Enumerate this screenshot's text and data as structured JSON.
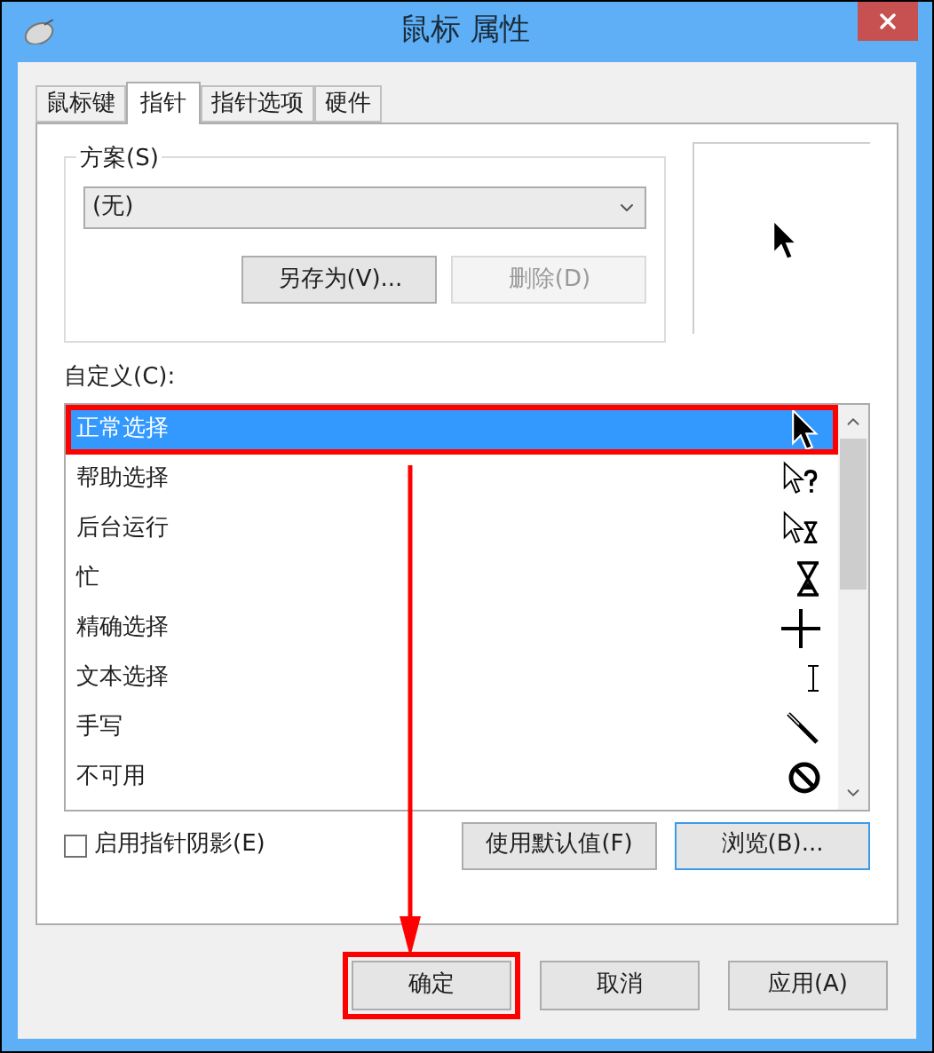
{
  "window": {
    "title": "鼠标 属性"
  },
  "tabs": [
    {
      "label": "鼠标键",
      "selected": false
    },
    {
      "label": "指针",
      "selected": true
    },
    {
      "label": "指针选项",
      "selected": false
    },
    {
      "label": "硬件",
      "selected": false
    }
  ],
  "scheme": {
    "label": "方案(S)",
    "value": "(无)",
    "buttons": [
      {
        "label": "另存为(V)...",
        "disabled": false
      },
      {
        "label": "删除(D)",
        "disabled": true
      }
    ]
  },
  "customize_label": "自定义(C):",
  "cursors": [
    {
      "name": "正常选择",
      "kind": "arrow",
      "selected": true,
      "highlighted": true
    },
    {
      "name": "帮助选择",
      "kind": "help",
      "selected": false,
      "highlighted": false
    },
    {
      "name": "后台运行",
      "kind": "working",
      "selected": false,
      "highlighted": false
    },
    {
      "name": "忙",
      "kind": "busy",
      "selected": false,
      "highlighted": false
    },
    {
      "name": "精确选择",
      "kind": "precision",
      "selected": false,
      "highlighted": false
    },
    {
      "name": "文本选择",
      "kind": "text",
      "selected": false,
      "highlighted": false
    },
    {
      "name": "手写",
      "kind": "handwriting",
      "selected": false,
      "highlighted": false
    },
    {
      "name": "不可用",
      "kind": "unavailable",
      "selected": false,
      "highlighted": false
    }
  ],
  "shadow": {
    "label": "启用指针阴影(E)",
    "checked": false
  },
  "list_buttons": [
    {
      "label": "使用默认值(F)",
      "focused": false
    },
    {
      "label": "浏览(B)...",
      "focused": true
    }
  ],
  "footer_buttons": [
    {
      "label": "确定",
      "highlighted": true
    },
    {
      "label": "取消",
      "highlighted": false
    },
    {
      "label": "应用(A)",
      "highlighted": false
    }
  ]
}
